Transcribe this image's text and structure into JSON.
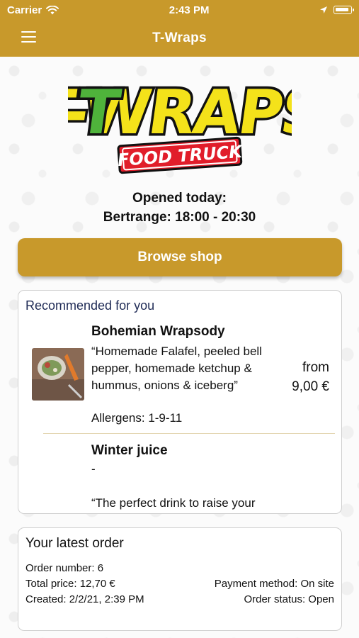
{
  "status_bar": {
    "carrier": "Carrier",
    "time": "2:43 PM"
  },
  "nav": {
    "title": "T-Wraps"
  },
  "logo": {
    "line1": "T-WRAPS",
    "line2": "FOOD TRUCK",
    "colors": {
      "green": "#4fb33b",
      "yellow": "#f4e21a",
      "red": "#e11d2a"
    }
  },
  "opening": {
    "line1": "Opened today:",
    "line2": "Bertrange: 18:00 - 20:30"
  },
  "browse_button": {
    "label": "Browse shop"
  },
  "recommended": {
    "heading": "Recommended for you",
    "items": [
      {
        "name": "Bohemian Wrapsody",
        "description": "“Homemade Falafel, peeled bell pepper, homemade ketchup & hummus, onions & iceberg”",
        "price_prefix": "from",
        "price": "9,00 €",
        "allergens": "Allergens: 1-9-11"
      },
      {
        "name": "Winter juice",
        "subtitle": "-",
        "description": "“The perfect drink to raise your"
      }
    ]
  },
  "latest_order": {
    "heading": "Your latest order",
    "order_number": "Order number: 6",
    "total_price": "Total price: 12,70 €",
    "created": "Created: 2/2/21, 2:39 PM",
    "payment_method": "Payment method: On site",
    "order_status": "Order status: Open"
  },
  "theme": {
    "accent": "#c8992b",
    "heading_blue": "#1e2a55"
  }
}
